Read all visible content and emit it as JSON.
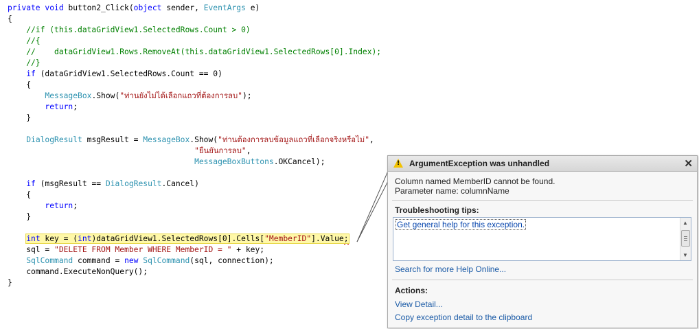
{
  "editor": {
    "line1": {
      "a": "private void",
      "b": " button2_Click(",
      "c": "object",
      "d": " sender, ",
      "e": "EventArgs",
      "f": " e)"
    },
    "line2": "{",
    "line3": "    //if (this.dataGridView1.SelectedRows.Count > 0)",
    "line4": "    //{",
    "line5": "    //    dataGridView1.Rows.RemoveAt(this.dataGridView1.SelectedRows[0].Index);",
    "line6": "    //}",
    "line7": {
      "a": "    ",
      "b": "if",
      "c": " (dataGridView1.SelectedRows.Count == 0)"
    },
    "line8": "    {",
    "line9": {
      "a": "        ",
      "b": "MessageBox",
      "c": ".Show(",
      "d": "\"ท่านยังไม่ได้เลือกแถวที่ต้องการลบ\"",
      "e": ");"
    },
    "line10": {
      "a": "        ",
      "b": "return",
      "c": ";"
    },
    "line11": "    }",
    "line12": "",
    "line13": {
      "a": "    ",
      "b": "DialogResult",
      "c": " msgResult = ",
      "d": "MessageBox",
      "e": ".Show(",
      "f": "\"ท่านต้องการลบข้อมูลแถวที่เลือกจริงหรือไม่\"",
      "g": ","
    },
    "line14": {
      "a": "                                        ",
      "b": "\"ยืนยันการลบ\"",
      "c": ","
    },
    "line15": {
      "a": "                                        ",
      "b": "MessageBoxButtons",
      "c": ".OKCancel);"
    },
    "line16": "",
    "line17": {
      "a": "    ",
      "b": "if",
      "c": " (msgResult == ",
      "d": "DialogResult",
      "e": ".Cancel)"
    },
    "line18": "    {",
    "line19": {
      "a": "        ",
      "b": "return",
      "c": ";"
    },
    "line20": "    }",
    "line21": "",
    "line22": {
      "a": "    ",
      "b": "int",
      "c": " key = (",
      "d": "int",
      "e": ")dataGridView1.SelectedRows[0].Cells[",
      "f": "\"MemberID\"",
      "g": "].Value",
      "h": ";"
    },
    "line23": {
      "a": "    sql = ",
      "b": "\"DELETE FROM Member WHERE MemberID = \"",
      "c": " + key;"
    },
    "line24": {
      "a": "    ",
      "b": "SqlCommand",
      "c": " command = ",
      "d": "new",
      "e": " ",
      "f": "SqlCommand",
      "g": "(sql, connection);"
    },
    "line25": "    command.ExecuteNonQuery();",
    "line26": "}"
  },
  "exception": {
    "title": "ArgumentException was unhandled",
    "close": "✕",
    "warning_glyph": "!",
    "message_line1": "Column named MemberID cannot be found.",
    "message_line2": "Parameter name: columnName",
    "tips_heading": "Troubleshooting tips:",
    "tip_link": "Get general help for this exception.",
    "search_link": "Search for more Help Online...",
    "actions_heading": "Actions:",
    "view_detail": "View Detail...",
    "copy_detail": "Copy exception detail to the clipboard",
    "scroll_up": "▲",
    "scroll_down": "▼"
  },
  "icons": {
    "warning": "warning-icon",
    "close": "close-icon"
  },
  "colors": {
    "keyword": "#0000ff",
    "type": "#2b91af",
    "string": "#a31515",
    "comment": "#008000",
    "highlight": "#fff8a8"
  }
}
